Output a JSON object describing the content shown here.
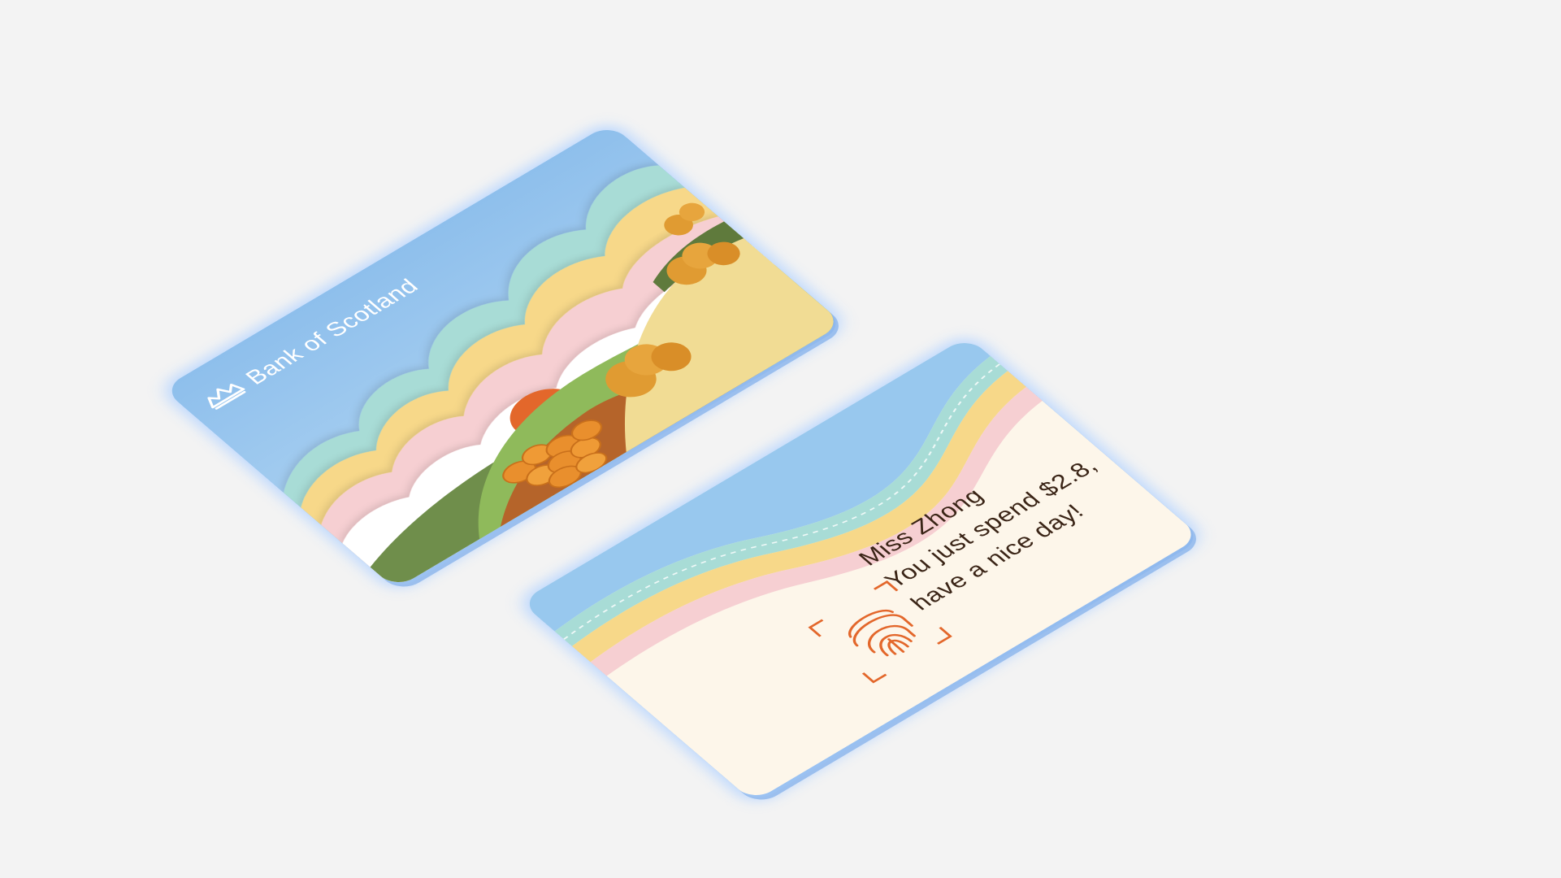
{
  "cards": {
    "front": {
      "brand_name": "Bank of Scotland",
      "logo_icon": "ship-icon"
    },
    "back": {
      "greeting": "Miss Zhong",
      "message_line1": "You just spend $2.8,",
      "message_line2": "have a nice day!",
      "fingerprint_icon": "fingerprint-icon"
    }
  },
  "colors": {
    "background": "#f3f3f3",
    "sky": "#9ec8ee",
    "cloud_teal": "#a8dcd6",
    "cloud_yellow": "#f7d889",
    "cloud_pink": "#f6cfd2",
    "field_green": "#8fba5b",
    "field_yellow": "#f1dc94",
    "soil_brown": "#b5642a",
    "pumpkin": "#e98f2d",
    "tree_orange": "#e09b32",
    "sun": "#e3672b",
    "back_cream": "#fdf6ea",
    "text_dark": "#3a2416",
    "fingerprint_orange": "#e3672b"
  }
}
